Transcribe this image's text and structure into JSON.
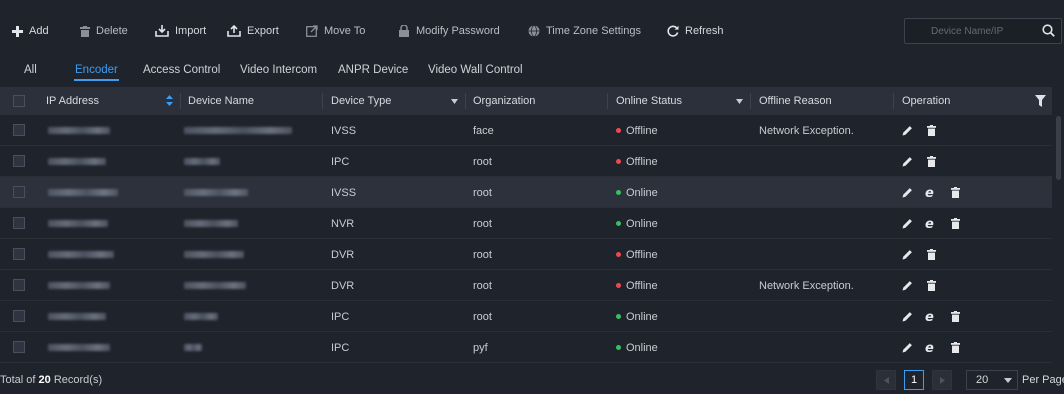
{
  "toolbar": {
    "add": "Add",
    "delete": "Delete",
    "import": "Import",
    "export": "Export",
    "move_to": "Move To",
    "modify_password": "Modify Password",
    "time_zone": "Time Zone Settings",
    "refresh": "Refresh"
  },
  "search": {
    "placeholder": "Device Name/IP"
  },
  "tabs": [
    "All",
    "Encoder",
    "Access Control",
    "Video Intercom",
    "ANPR Device",
    "Video Wall Control"
  ],
  "active_tab": "Encoder",
  "columns": {
    "ip": "IP Address",
    "name": "Device Name",
    "type": "Device Type",
    "org": "Organization",
    "status": "Online Status",
    "reason": "Offline Reason",
    "operation": "Operation"
  },
  "rows": [
    {
      "type": "IVSS",
      "org": "face",
      "status": "Offline",
      "reason": "Network Exception.",
      "ops": [
        "edit",
        "delete"
      ]
    },
    {
      "type": "IPC",
      "org": "root",
      "status": "Offline",
      "reason": "",
      "ops": [
        "edit",
        "delete"
      ]
    },
    {
      "type": "IVSS",
      "org": "root",
      "status": "Online",
      "reason": "",
      "ops": [
        "edit",
        "web",
        "delete"
      ]
    },
    {
      "type": "NVR",
      "org": "root",
      "status": "Online",
      "reason": "",
      "ops": [
        "edit",
        "web",
        "delete"
      ]
    },
    {
      "type": "DVR",
      "org": "root",
      "status": "Offline",
      "reason": "",
      "ops": [
        "edit",
        "delete"
      ]
    },
    {
      "type": "DVR",
      "org": "root",
      "status": "Offline",
      "reason": "Network Exception.",
      "ops": [
        "edit",
        "delete"
      ]
    },
    {
      "type": "IPC",
      "org": "root",
      "status": "Online",
      "reason": "",
      "ops": [
        "edit",
        "web",
        "delete"
      ]
    },
    {
      "type": "IPC",
      "org": "pyf",
      "status": "Online",
      "reason": "",
      "ops": [
        "edit",
        "web",
        "delete"
      ]
    }
  ],
  "footer": {
    "total_prefix": "Total of ",
    "total_count": "20",
    "total_suffix": " Record(s)",
    "page": "1",
    "page_size": "20",
    "per_page": "Per Page"
  },
  "colors": {
    "accent": "#3e9df0",
    "online": "#35c25e",
    "offline": "#f0484f",
    "background": "#1f232b",
    "header": "#2b303a"
  }
}
